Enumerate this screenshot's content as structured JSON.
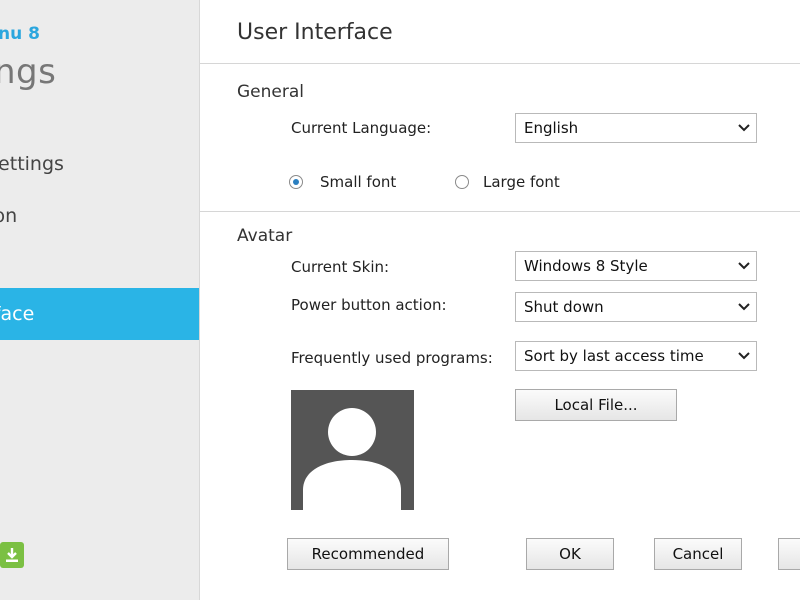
{
  "sidebar": {
    "app_name": "nu 8",
    "heading": "ngs",
    "items": [
      {
        "label": "Settings"
      },
      {
        "label": "ton"
      },
      {
        "label": "rface"
      }
    ]
  },
  "main": {
    "title": "User Interface",
    "general": {
      "section_label": "General",
      "language_label": "Current Language:",
      "language_value": "English",
      "small_font_label": "Small font",
      "large_font_label": "Large font",
      "selected_font": "small"
    },
    "avatar": {
      "section_label": "Avatar",
      "skin_label": "Current Skin:",
      "skin_value": "Windows 8 Style",
      "power_label": "Power button action:",
      "power_value": "Shut down",
      "programs_label": "Frequently used programs:",
      "programs_value": "Sort by last access time",
      "local_file_label": "Local File..."
    }
  },
  "footer": {
    "recommended_label": "Recommended",
    "ok_label": "OK",
    "cancel_label": "Cancel"
  },
  "colors": {
    "accent": "#2ab4e6",
    "app_name": "#2ba6de",
    "download": "#7bc043"
  }
}
